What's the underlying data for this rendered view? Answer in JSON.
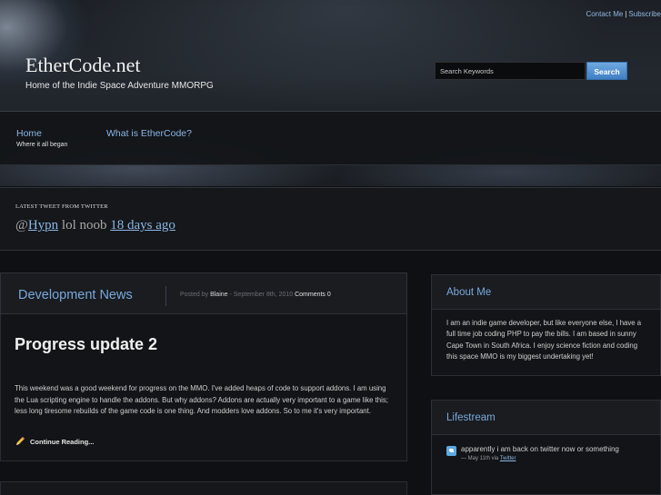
{
  "top_links": {
    "contact": "Contact Me",
    "separator": "|",
    "subscribe": "Subscribe"
  },
  "header": {
    "site_title": "EtherCode.net",
    "tagline": "Home of the Indie Space Adventure MMORPG",
    "search_placeholder": "Search Keywords",
    "search_button": "Search"
  },
  "nav": {
    "items": [
      {
        "label": "Home",
        "sub": "Where it all began"
      },
      {
        "label": "What is EtherCode?",
        "sub": ""
      }
    ]
  },
  "tweet": {
    "heading": "LATEST TWEET FROM TWITTER",
    "at": "@",
    "user": "Hypn",
    "text": " lol noob ",
    "time": "18 days ago"
  },
  "post_header": {
    "category": "Development News",
    "posted_by": "Posted by ",
    "author": "Blaine",
    "date": " - September 8th, 2010 ",
    "comments": "Comments 0"
  },
  "post": {
    "title": "Progress update 2",
    "excerpt": "This weekend was a good weekend for progress on the MMO. I've added heaps of code to support addons. I am using the Lua scripting engine to handle the addons. But why addons? Addons are actually very important to a game like this; less long tiresome rebuilds of the game code is one thing. And modders love addons. So to me it's very important.",
    "continue": "Continue Reading..."
  },
  "sidebar": {
    "about": {
      "title": "About Me",
      "text": "I am an indie game developer, but like everyone else, I have a full time job coding PHP to pay the bills. I am based in sunny Cape Town in South Africa. I enjoy science fiction and coding this space MMO is my biggest undertaking yet!"
    },
    "lifestream": {
      "title": "Lifestream",
      "item_text": "apparently i am back on twitter now or something",
      "item_meta": "— May 11th via ",
      "item_source": "Twitter"
    }
  },
  "colors": {
    "accent": "#78a9dc",
    "button": "#4f8fd1",
    "background": "#0e1013"
  }
}
